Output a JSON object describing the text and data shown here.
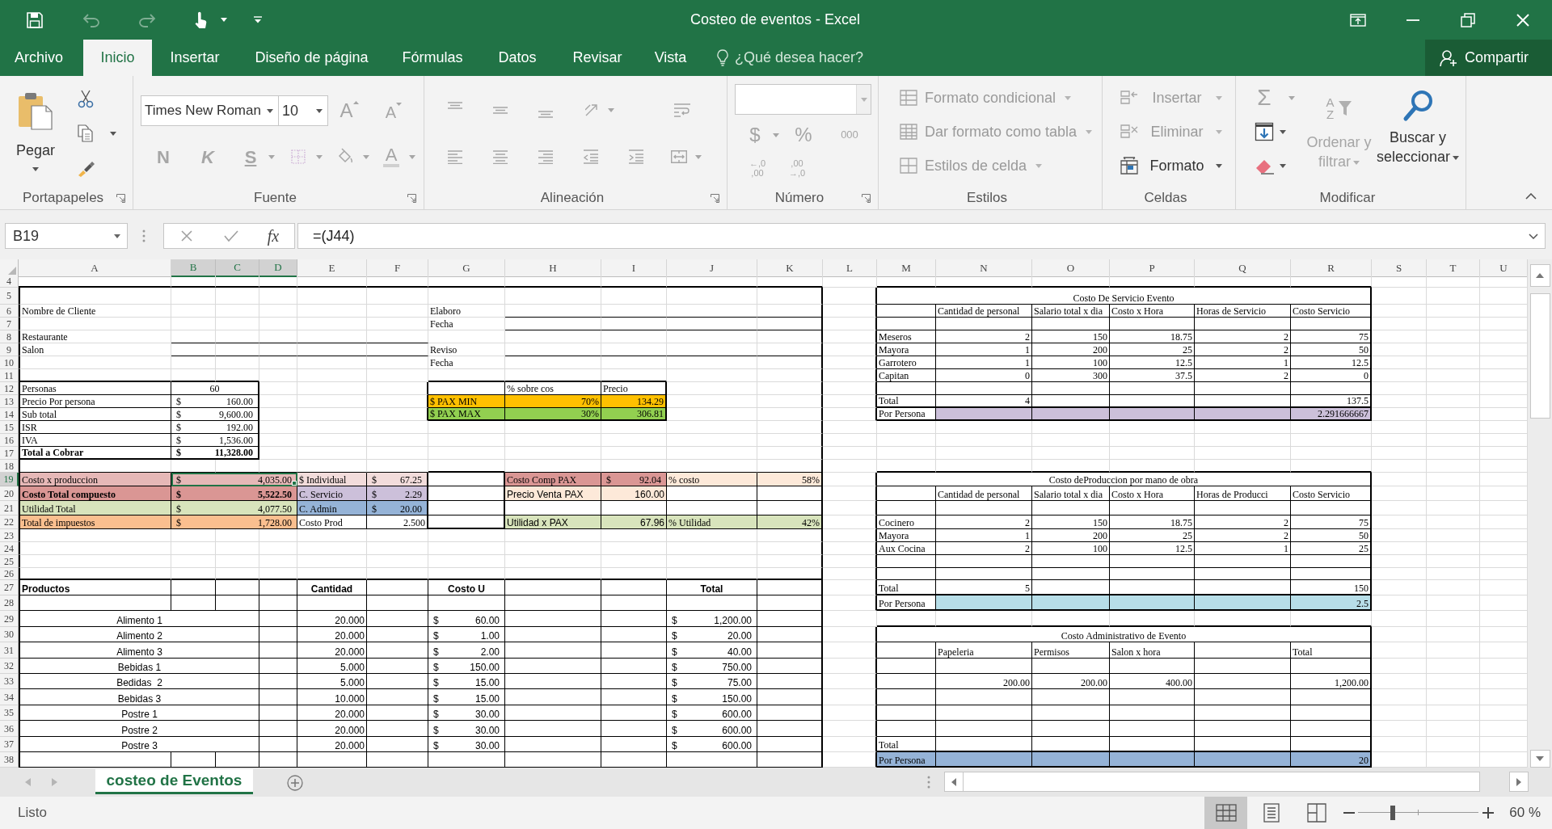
{
  "window": {
    "title": "Costeo de eventos - Excel"
  },
  "quick_access": {
    "undo": {
      "disabled": true
    },
    "redo": {
      "disabled": true
    }
  },
  "tabs": [
    {
      "label": "Archivo",
      "selected": false
    },
    {
      "label": "Inicio",
      "selected": true
    },
    {
      "label": "Insertar",
      "selected": false
    },
    {
      "label": "Diseño de página",
      "selected": false
    },
    {
      "label": "Fórmulas",
      "selected": false
    },
    {
      "label": "Datos",
      "selected": false
    },
    {
      "label": "Revisar",
      "selected": false
    },
    {
      "label": "Vista",
      "selected": false
    }
  ],
  "tell_me": {
    "placeholder": "¿Qué desea hacer?"
  },
  "share": {
    "label": "Compartir"
  },
  "ribbon": {
    "groups": [
      {
        "kind": "clipboard",
        "label": "Portapapeles",
        "paste": {
          "label": "Pegar",
          "disabled": false
        }
      },
      {
        "kind": "font",
        "label": "Fuente",
        "disabled": true,
        "font_name": "Times New Roman",
        "font_size": "10",
        "grow_font": "A",
        "shrink_font": "A",
        "bold": "N",
        "italic": "K",
        "underline": "S",
        "font_color": "A"
      },
      {
        "kind": "alignment",
        "label": "Alineación",
        "disabled": true
      },
      {
        "kind": "number",
        "label": "Número",
        "disabled": true,
        "currency": "$",
        "percent": "%",
        "thousands": "000",
        "increase_decimal": [
          "←,0",
          ",00"
        ],
        "decrease_decimal": [
          ",00",
          "→,0"
        ]
      },
      {
        "kind": "styles",
        "label": "Estilos",
        "buttons": [
          {
            "label": "Formato condicional",
            "disabled": true
          },
          {
            "label": "Dar formato como tabla",
            "disabled": true
          },
          {
            "label": "Estilos de celda",
            "disabled": true
          }
        ]
      },
      {
        "kind": "cells",
        "label": "Celdas",
        "buttons": [
          {
            "label": "Insertar",
            "disabled": true
          },
          {
            "label": "Eliminar",
            "disabled": true
          },
          {
            "label": "Formato",
            "disabled": false
          }
        ]
      },
      {
        "kind": "editing",
        "label": "Modificar",
        "autosum": {
          "label": "Σ",
          "disabled": true
        },
        "fill": {
          "disabled": false
        },
        "clear": {
          "disabled": false
        },
        "sort": {
          "label": "Ordenar y filtrar",
          "letters": [
            "A",
            "Z"
          ],
          "disabled": true
        },
        "find": {
          "label": "Buscar y seleccionar",
          "disabled": false
        }
      }
    ]
  },
  "formula_bar": {
    "name_box": "B19",
    "function_label": "fx",
    "formula": "=(J44)"
  },
  "sheet": {
    "columns": [
      {
        "label": "A",
        "selected": false
      },
      {
        "label": "B",
        "selected": true
      },
      {
        "label": "C",
        "selected": true
      },
      {
        "label": "D",
        "selected": true
      },
      {
        "label": "E",
        "selected": false
      },
      {
        "label": "F",
        "selected": false
      },
      {
        "label": "G",
        "selected": false
      },
      {
        "label": "H",
        "selected": false
      },
      {
        "label": "I",
        "selected": false
      },
      {
        "label": "J",
        "selected": false
      },
      {
        "label": "K",
        "selected": false
      },
      {
        "label": "L",
        "selected": false
      },
      {
        "label": "M",
        "selected": false
      },
      {
        "label": "N",
        "selected": false
      },
      {
        "label": "O",
        "selected": false
      },
      {
        "label": "P",
        "selected": false
      },
      {
        "label": "Q",
        "selected": false
      },
      {
        "label": "R",
        "selected": false
      },
      {
        "label": "S",
        "selected": false
      },
      {
        "label": "T",
        "selected": false
      },
      {
        "label": "U",
        "selected": false
      }
    ],
    "rows": [
      {
        "number": "4",
        "selected": false
      },
      {
        "number": "5",
        "selected": false,
        "cells": {
          "M:R": {
            "text": "Costo De Servicio Evento",
            "kind": "center"
          }
        }
      },
      {
        "number": "6",
        "selected": false,
        "cells": {
          "A": {
            "text": "Nombre de Cliente",
            "kind": "label"
          },
          "G": {
            "text": "Elaboro",
            "kind": "label"
          },
          "N": {
            "text": "Cantidad de personal",
            "kind": "label"
          },
          "O": {
            "text": "Salario total x dia",
            "kind": "label"
          },
          "P": {
            "text": "Costo x Hora",
            "kind": "label"
          },
          "Q": {
            "text": "Horas de Servicio",
            "kind": "label"
          },
          "R": {
            "text": "Costo Servicio",
            "kind": "label"
          }
        }
      },
      {
        "number": "7",
        "selected": false,
        "cells": {
          "G": {
            "text": "Fecha",
            "kind": "label"
          }
        }
      },
      {
        "number": "8",
        "selected": false,
        "cells": {
          "A": {
            "text": "Restaurante",
            "kind": "label"
          },
          "M": {
            "text": "Meseros",
            "kind": "label"
          },
          "N": {
            "text": "2",
            "kind": "num"
          },
          "O": {
            "text": "150",
            "kind": "num"
          },
          "P": {
            "text": "18.75",
            "kind": "num"
          },
          "Q": {
            "text": "2",
            "kind": "num"
          },
          "R": {
            "text": "75",
            "kind": "num"
          }
        }
      },
      {
        "number": "9",
        "selected": false,
        "cells": {
          "A": {
            "text": "Salon",
            "kind": "label"
          },
          "G": {
            "text": "Reviso",
            "kind": "label"
          },
          "M": {
            "text": "Mayora",
            "kind": "label"
          },
          "N": {
            "text": "1",
            "kind": "num"
          },
          "O": {
            "text": "200",
            "kind": "num"
          },
          "P": {
            "text": "25",
            "kind": "num"
          },
          "Q": {
            "text": "2",
            "kind": "num"
          },
          "R": {
            "text": "50",
            "kind": "num"
          }
        }
      },
      {
        "number": "10",
        "selected": false,
        "cells": {
          "G": {
            "text": "Fecha",
            "kind": "label"
          },
          "M": {
            "text": "Garrotero",
            "kind": "label"
          },
          "N": {
            "text": "1",
            "kind": "num"
          },
          "O": {
            "text": "100",
            "kind": "num"
          },
          "P": {
            "text": "12.5",
            "kind": "num"
          },
          "Q": {
            "text": "1",
            "kind": "num"
          },
          "R": {
            "text": "12.5",
            "kind": "num"
          }
        }
      },
      {
        "number": "11",
        "selected": false,
        "cells": {
          "M": {
            "text": "Capitan",
            "kind": "label"
          },
          "N": {
            "text": "0",
            "kind": "num"
          },
          "O": {
            "text": "300",
            "kind": "num"
          },
          "P": {
            "text": "37.5",
            "kind": "num"
          },
          "Q": {
            "text": "2",
            "kind": "num"
          },
          "R": {
            "text": "0",
            "kind": "num"
          }
        }
      },
      {
        "number": "12",
        "selected": false,
        "cells": {
          "A": {
            "text": "Personas",
            "kind": "label"
          },
          "B:C": {
            "text": "60",
            "kind": "center"
          },
          "H": {
            "text": "% sobre cos",
            "kind": "label"
          },
          "I": {
            "text": "Precio",
            "kind": "label"
          }
        }
      },
      {
        "number": "13",
        "selected": false,
        "cells": {
          "A": {
            "text": "Precio Por persona",
            "kind": "label"
          },
          "B:C": {
            "currency": "$",
            "text": "160.00",
            "kind": "num"
          },
          "G": {
            "text": "$ PAX MIN",
            "kind": "label",
            "color": "#ffc000"
          },
          "H": {
            "text": "70%",
            "kind": "num",
            "color": "#ffc000"
          },
          "I": {
            "text": "134.29",
            "kind": "num",
            "color": "#ffc000"
          },
          "M": {
            "text": "Total",
            "kind": "label"
          },
          "N": {
            "text": "4",
            "kind": "num"
          },
          "R": {
            "text": "137.5",
            "kind": "num"
          }
        }
      },
      {
        "number": "14",
        "selected": false,
        "cells": {
          "A": {
            "text": "Sub total",
            "kind": "label"
          },
          "B:C": {
            "currency": "$",
            "text": "9,600.00",
            "kind": "num"
          },
          "G": {
            "text": "$ PAX MAX",
            "kind": "label",
            "color": "#92d050"
          },
          "H": {
            "text": "30%",
            "kind": "num",
            "color": "#92d050"
          },
          "I": {
            "text": "306.81",
            "kind": "num",
            "color": "#92d050"
          },
          "M": {
            "text": "Por Persona",
            "kind": "label"
          },
          "N": {
            "color": "#ccc0da"
          },
          "O": {
            "color": "#ccc0da"
          },
          "P": {
            "color": "#ccc0da"
          },
          "Q": {
            "color": "#ccc0da"
          },
          "R": {
            "text": "2.291666667",
            "kind": "num",
            "color": "#ccc0da"
          }
        }
      },
      {
        "number": "15",
        "selected": false,
        "cells": {
          "A": {
            "text": "ISR",
            "kind": "label"
          },
          "B:C": {
            "currency": "$",
            "text": "192.00",
            "kind": "num"
          }
        }
      },
      {
        "number": "16",
        "selected": false,
        "cells": {
          "A": {
            "text": "IVA",
            "kind": "label"
          },
          "B:C": {
            "currency": "$",
            "text": "1,536.00",
            "kind": "num"
          }
        }
      },
      {
        "number": "17",
        "selected": false,
        "cells": {
          "A": {
            "text": "Total a Cobrar",
            "kind": "label-bold"
          },
          "B:C": {
            "currency": "$",
            "text": "11,328.00",
            "kind": "num-bold"
          }
        }
      },
      {
        "number": "18",
        "selected": false
      },
      {
        "number": "19",
        "selected": true,
        "cells": {
          "A": {
            "text": "Costo x produccion",
            "kind": "label",
            "color": "#e6b8b7"
          },
          "B:D": {
            "currency": "$",
            "text": "4,035.00",
            "kind": "num",
            "color": "#e6b8b7"
          },
          "E": {
            "text": "$ Individual",
            "kind": "label",
            "color": "#f2dcdb"
          },
          "F": {
            "currency": "$",
            "text": "67.25",
            "kind": "num",
            "color": "#f2dcdb"
          },
          "H": {
            "text": "Costo Comp PAX",
            "kind": "label",
            "color": "#da9694"
          },
          "I": {
            "currency": "$",
            "text": "92.04",
            "kind": "num",
            "color": "#da9694"
          },
          "J": {
            "text": "% costo",
            "kind": "label",
            "color": "#fde9d9"
          },
          "K": {
            "text": "58%",
            "kind": "num",
            "color": "#fde9d9"
          },
          "M:R": {
            "text": "Costo deProduccion por mano de obra",
            "kind": "center"
          }
        }
      },
      {
        "number": "20",
        "selected": false,
        "cells": {
          "A": {
            "text": "Costo Total compuesto",
            "kind": "label-bold",
            "color": "#da9694"
          },
          "B:D": {
            "currency": "$",
            "text": "5,522.50",
            "kind": "num-bold",
            "color": "#da9694"
          },
          "E": {
            "text": "C. Servicio",
            "kind": "label",
            "color": "#ccc0da"
          },
          "F": {
            "currency": "$",
            "text": "2.29",
            "kind": "num",
            "color": "#ccc0da"
          },
          "H": {
            "text": "Precio Venta PAX",
            "kind": "sans",
            "color": "#fde9d9"
          },
          "I": {
            "text": "160.00",
            "kind": "sans-num",
            "color": "#fde9d9"
          },
          "N": {
            "text": "Cantidad de personal",
            "kind": "label"
          },
          "O": {
            "text": "Salario total x dia",
            "kind": "label"
          },
          "P": {
            "text": "Costo x Hora",
            "kind": "label"
          },
          "Q": {
            "text": "Horas de Producci",
            "kind": "label"
          },
          "R": {
            "text": "Costo Servicio",
            "kind": "label"
          }
        }
      },
      {
        "number": "21",
        "selected": false,
        "cells": {
          "A": {
            "text": "Utilidad Total",
            "kind": "label",
            "color": "#d8e4bc"
          },
          "B:D": {
            "currency": "$",
            "text": "4,077.50",
            "kind": "num",
            "color": "#d8e4bc"
          },
          "E": {
            "text": "C. Admin",
            "kind": "label",
            "color": "#95b3d7"
          },
          "F": {
            "currency": "$",
            "text": "20.00",
            "kind": "num",
            "color": "#95b3d7"
          }
        }
      },
      {
        "number": "22",
        "selected": false,
        "cells": {
          "A": {
            "text": "Total de impuestos",
            "kind": "label",
            "color": "#fabf8f"
          },
          "B:D": {
            "currency": "$",
            "text": "1,728.00",
            "kind": "num",
            "color": "#fabf8f"
          },
          "E": {
            "text": "Costo Prod",
            "kind": "label"
          },
          "F": {
            "text": "2.500",
            "kind": "num"
          },
          "H": {
            "text": "Utilidad x PAX",
            "kind": "sans",
            "color": "#d8e4bc"
          },
          "I": {
            "text": "67.96",
            "kind": "sans-num",
            "color": "#d8e4bc"
          },
          "J": {
            "text": "% Utilidad",
            "kind": "label",
            "color": "#d8e4bc"
          },
          "K": {
            "text": "42%",
            "kind": "num",
            "color": "#d8e4bc"
          },
          "M": {
            "text": "Cocinero",
            "kind": "label"
          },
          "N": {
            "text": "2",
            "kind": "num"
          },
          "O": {
            "text": "150",
            "kind": "num"
          },
          "P": {
            "text": "18.75",
            "kind": "num"
          },
          "Q": {
            "text": "2",
            "kind": "num"
          },
          "R": {
            "text": "75",
            "kind": "num"
          }
        }
      },
      {
        "number": "23",
        "selected": false,
        "cells": {
          "M": {
            "text": "Mayora",
            "kind": "label"
          },
          "N": {
            "text": "1",
            "kind": "num"
          },
          "O": {
            "text": "200",
            "kind": "num"
          },
          "P": {
            "text": "25",
            "kind": "num"
          },
          "Q": {
            "text": "2",
            "kind": "num"
          },
          "R": {
            "text": "50",
            "kind": "num"
          }
        }
      },
      {
        "number": "24",
        "selected": false,
        "cells": {
          "M": {
            "text": "Aux Cocina",
            "kind": "label"
          },
          "N": {
            "text": "2",
            "kind": "num"
          },
          "O": {
            "text": "100",
            "kind": "num"
          },
          "P": {
            "text": "12.5",
            "kind": "num"
          },
          "Q": {
            "text": "1",
            "kind": "num"
          },
          "R": {
            "text": "25",
            "kind": "num"
          }
        }
      },
      {
        "number": "25",
        "selected": false
      },
      {
        "number": "26",
        "selected": false
      },
      {
        "number": "27",
        "selected": false,
        "cells": {
          "A": {
            "text": "Productos",
            "kind": "heading"
          },
          "E": {
            "text": "Cantidad",
            "kind": "heading-center"
          },
          "G": {
            "text": "Costo U",
            "kind": "heading-center"
          },
          "J": {
            "text": "Total",
            "kind": "heading-center"
          },
          "M": {
            "text": "Total",
            "kind": "label"
          },
          "N": {
            "text": "5",
            "kind": "num"
          },
          "R": {
            "text": "150",
            "kind": "num"
          }
        }
      },
      {
        "number": "28",
        "selected": false,
        "cells": {
          "M": {
            "text": "Por Persona",
            "kind": "label"
          },
          "N": {
            "color": "#b7dee8"
          },
          "O": {
            "color": "#b7dee8"
          },
          "P": {
            "color": "#b7dee8"
          },
          "Q": {
            "color": "#b7dee8"
          },
          "R": {
            "text": "2.5",
            "kind": "num",
            "color": "#b7dee8"
          }
        }
      },
      {
        "number": "29",
        "selected": false,
        "cells": {
          "A:C": {
            "text": "Alimento 1",
            "kind": "sans-center"
          },
          "E": {
            "text": "20.000",
            "kind": "sans-num"
          },
          "G": {
            "currency": "$",
            "text": "60.00",
            "kind": "sans-num"
          },
          "J": {
            "currency": "$",
            "text": "1,200.00",
            "kind": "sans-num"
          }
        }
      },
      {
        "number": "30",
        "selected": false,
        "cells": {
          "A:C": {
            "text": "Alimento 2",
            "kind": "sans-center"
          },
          "E": {
            "text": "20.000",
            "kind": "sans-num"
          },
          "G": {
            "currency": "$",
            "text": "1.00",
            "kind": "sans-num"
          },
          "J": {
            "currency": "$",
            "text": "20.00",
            "kind": "sans-num"
          },
          "M:R": {
            "text": "Costo Administrativo de Evento",
            "kind": "center"
          }
        }
      },
      {
        "number": "31",
        "selected": false,
        "cells": {
          "A:C": {
            "text": "Alimento 3",
            "kind": "sans-center"
          },
          "E": {
            "text": "20.000",
            "kind": "sans-num"
          },
          "G": {
            "currency": "$",
            "text": "2.00",
            "kind": "sans-num"
          },
          "J": {
            "currency": "$",
            "text": "40.00",
            "kind": "sans-num"
          },
          "N": {
            "text": "Papeleria",
            "kind": "label"
          },
          "O": {
            "text": "Permisos",
            "kind": "label"
          },
          "P": {
            "text": "Salon x hora",
            "kind": "label"
          },
          "R": {
            "text": "Total",
            "kind": "label"
          }
        }
      },
      {
        "number": "32",
        "selected": false,
        "cells": {
          "A:C": {
            "text": "Bebidas 1",
            "kind": "sans-center"
          },
          "E": {
            "text": "5.000",
            "kind": "sans-num"
          },
          "G": {
            "currency": "$",
            "text": "150.00",
            "kind": "sans-num"
          },
          "J": {
            "currency": "$",
            "text": "750.00",
            "kind": "sans-num"
          }
        }
      },
      {
        "number": "33",
        "selected": false,
        "cells": {
          "A:C": {
            "text": "Bedidas  2",
            "kind": "sans-center"
          },
          "E": {
            "text": "5.000",
            "kind": "sans-num"
          },
          "G": {
            "currency": "$",
            "text": "15.00",
            "kind": "sans-num"
          },
          "J": {
            "currency": "$",
            "text": "75.00",
            "kind": "sans-num"
          },
          "N": {
            "text": "200.00",
            "kind": "num"
          },
          "O": {
            "text": "200.00",
            "kind": "num"
          },
          "P": {
            "text": "400.00",
            "kind": "num"
          },
          "R": {
            "text": "1,200.00",
            "kind": "num"
          }
        }
      },
      {
        "number": "34",
        "selected": false,
        "cells": {
          "A:C": {
            "text": "Bebidas 3",
            "kind": "sans-center"
          },
          "E": {
            "text": "10.000",
            "kind": "sans-num"
          },
          "G": {
            "currency": "$",
            "text": "15.00",
            "kind": "sans-num"
          },
          "J": {
            "currency": "$",
            "text": "150.00",
            "kind": "sans-num"
          }
        }
      },
      {
        "number": "35",
        "selected": false,
        "cells": {
          "A:C": {
            "text": "Postre 1",
            "kind": "sans-center"
          },
          "E": {
            "text": "20.000",
            "kind": "sans-num"
          },
          "G": {
            "currency": "$",
            "text": "30.00",
            "kind": "sans-num"
          },
          "J": {
            "currency": "$",
            "text": "600.00",
            "kind": "sans-num"
          }
        }
      },
      {
        "number": "36",
        "selected": false,
        "cells": {
          "A:C": {
            "text": "Postre 2",
            "kind": "sans-center"
          },
          "E": {
            "text": "20.000",
            "kind": "sans-num"
          },
          "G": {
            "currency": "$",
            "text": "30.00",
            "kind": "sans-num"
          },
          "J": {
            "currency": "$",
            "text": "600.00",
            "kind": "sans-num"
          }
        }
      },
      {
        "number": "37",
        "selected": false,
        "cells": {
          "A:C": {
            "text": "Postre 3",
            "kind": "sans-center"
          },
          "E": {
            "text": "20.000",
            "kind": "sans-num"
          },
          "G": {
            "currency": "$",
            "text": "30.00",
            "kind": "sans-num"
          },
          "J": {
            "currency": "$",
            "text": "600.00",
            "kind": "sans-num"
          },
          "M": {
            "text": "Total",
            "kind": "label"
          }
        }
      },
      {
        "number": "38",
        "selected": false,
        "cells": {
          "M": {
            "text": "Por Persona",
            "kind": "label",
            "color": "#95b3d7"
          },
          "N": {
            "color": "#95b3d7"
          },
          "O": {
            "color": "#95b3d7"
          },
          "P": {
            "color": "#95b3d7"
          },
          "Q": {
            "color": "#95b3d7"
          },
          "R": {
            "text": "20",
            "kind": "num",
            "color": "#95b3d7"
          }
        }
      }
    ]
  },
  "sheet_tabs": [
    {
      "label": "costeo de Eventos",
      "selected": true
    }
  ],
  "status_bar": {
    "status": "Listo",
    "views": [
      {
        "kind": "normal",
        "selected": true
      },
      {
        "kind": "page_layout",
        "selected": false
      },
      {
        "kind": "page_break",
        "selected": false
      }
    ],
    "zoom": {
      "level": 0.29,
      "reading": "60 %"
    }
  }
}
